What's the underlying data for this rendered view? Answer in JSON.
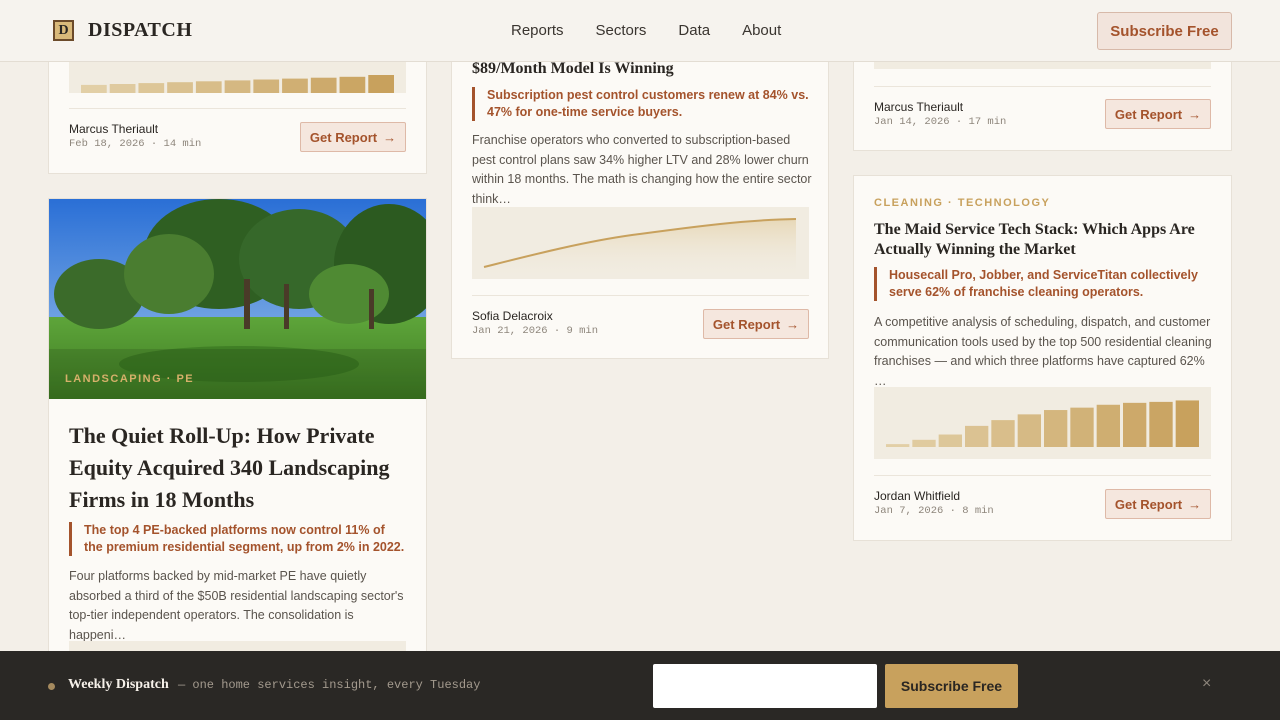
{
  "header": {
    "logo_mark": "D",
    "brand": "DISPATCH",
    "nav": [
      "Reports",
      "Sectors",
      "Data",
      "About"
    ],
    "subscribe_label": "Subscribe Free"
  },
  "cards": {
    "left_top": {
      "author": "Marcus Theriault",
      "meta": "Feb 18, 2026 · 14 min",
      "button": "Get Report",
      "bar_values": [
        0.45,
        0.5,
        0.55,
        0.6,
        0.65,
        0.7,
        0.75,
        0.8,
        0.85,
        0.9,
        1.0
      ]
    },
    "mid_top": {
      "title": "$89/Month Model Is Winning",
      "pull": "Subscription pest control customers renew at 84% vs. 47% for one-time service buyers.",
      "excerpt": "Franchise operators who converted to subscription-based pest control plans saw 34% higher LTV and 28% lower churn within 18 months. The math is changing how the entire sector think…",
      "author": "Sofia Delacroix",
      "meta": "Jan 21, 2026 · 9 min",
      "button": "Get Report"
    },
    "right_top": {
      "author": "Marcus Theriault",
      "meta": "Jan 14, 2026 · 17 min",
      "button": "Get Report"
    },
    "landscaping": {
      "tag": "LANDSCAPING · PE",
      "title": "The Quiet Roll-Up: How Private Equity Acquired 340 Landscaping Firms in 18 Months",
      "pull": "The top 4 PE-backed platforms now control 11% of the premium residential segment, up from 2% in 2022.",
      "excerpt": "Four platforms backed by mid-market PE have quietly absorbed a third of the $50B residential landscaping sector's top-tier independent operators. The consolidation is happeni…"
    },
    "cleaning": {
      "tag": "CLEANING · TECHNOLOGY",
      "title": "The Maid Service Tech Stack: Which Apps Are Actually Winning the Market",
      "pull": "Housecall Pro, Jobber, and ServiceTitan collectively serve 62% of franchise cleaning operators.",
      "excerpt": "A competitive analysis of scheduling, dispatch, and customer communication tools used by the top 500 residential cleaning franchises — and which three platforms have captured 62% …",
      "author": "Jordan Whitfield",
      "meta": "Jan 7, 2026 · 8 min",
      "button": "Get Report",
      "bar_values": [
        0.06,
        0.15,
        0.26,
        0.44,
        0.56,
        0.68,
        0.77,
        0.82,
        0.88,
        0.92,
        0.94,
        0.97
      ]
    }
  },
  "footer": {
    "title": "Weekly Dispatch",
    "subtitle": "— one home services insight, every Tuesday",
    "email_placeholder": "",
    "subscribe_label": "Subscribe Free",
    "close": "×"
  },
  "colors": {
    "accent": "#a4532c",
    "gold": "#c8a15d",
    "footer_bg": "#2a2825"
  }
}
